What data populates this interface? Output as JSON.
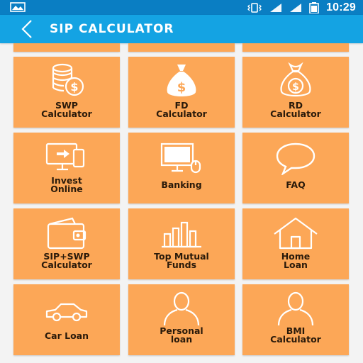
{
  "status_bar": {
    "time": "10:29",
    "icons": [
      "image-icon",
      "vibrate-icon",
      "signal-icon",
      "signal-icon",
      "battery-icon"
    ]
  },
  "app_bar": {
    "title": "SIP CALCULATOR",
    "back_icon": "chevron-left-icon"
  },
  "colors": {
    "status_bar": "#0a7ec3",
    "app_bar": "#14a3e3",
    "tile": "#fca757",
    "background": "#f3f3f3"
  },
  "tiles": [
    {
      "label": "SWP\nCalculator",
      "icon": "coins-dollar-icon"
    },
    {
      "label": "FD\nCalculator",
      "icon": "money-bag-icon"
    },
    {
      "label": "RD\nCalculator",
      "icon": "money-bag-outline-icon"
    },
    {
      "label": "Invest\nOnline",
      "icon": "monitor-phone-icon"
    },
    {
      "label": "Banking",
      "icon": "computer-mouse-icon"
    },
    {
      "label": "FAQ",
      "icon": "speech-bubble-icon"
    },
    {
      "label": "SIP+SWP\nCalculator",
      "icon": "wallet-icon"
    },
    {
      "label": "Top Mutual\nFunds",
      "icon": "bar-chart-icon"
    },
    {
      "label": "Home\nLoan",
      "icon": "house-icon"
    },
    {
      "label": "Car Loan",
      "icon": "car-icon"
    },
    {
      "label": "Personal\nloan",
      "icon": "person-icon"
    },
    {
      "label": "BMI\nCalculator",
      "icon": "person-outline-icon"
    }
  ]
}
